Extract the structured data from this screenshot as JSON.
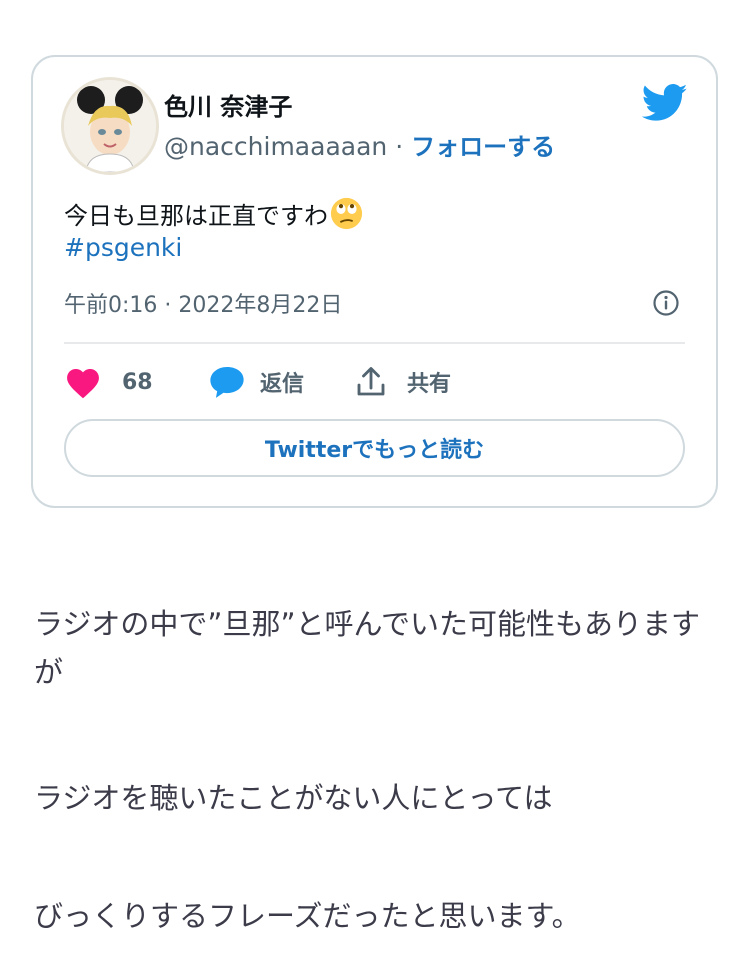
{
  "tweet": {
    "display_name": "色川 奈津子",
    "handle": "@nacchimaaaaan",
    "separator": " · ",
    "follow_label": "フォローする",
    "text": "今日も旦那は正直ですわ",
    "emoji": "face-with-rolling-eyes",
    "hashtag": "#psgenki",
    "timestamp": "午前0:16 · 2022年8月22日",
    "likes_count": "68",
    "reply_label": "返信",
    "share_label": "共有",
    "read_more_label": "Twitterでもっと読む",
    "colors": {
      "link": "#1d72bd",
      "twitter_blue": "#1d9bf0",
      "heart": "#f91880",
      "muted": "#536471",
      "border": "#cfd9de"
    }
  },
  "article": {
    "paragraphs": [
      "ラジオの中で”旦那”と呼んでいた可能性もありますが",
      "ラジオを聴いたことがない人にとっては",
      "びっくりするフレーズだったと思います。"
    ]
  }
}
